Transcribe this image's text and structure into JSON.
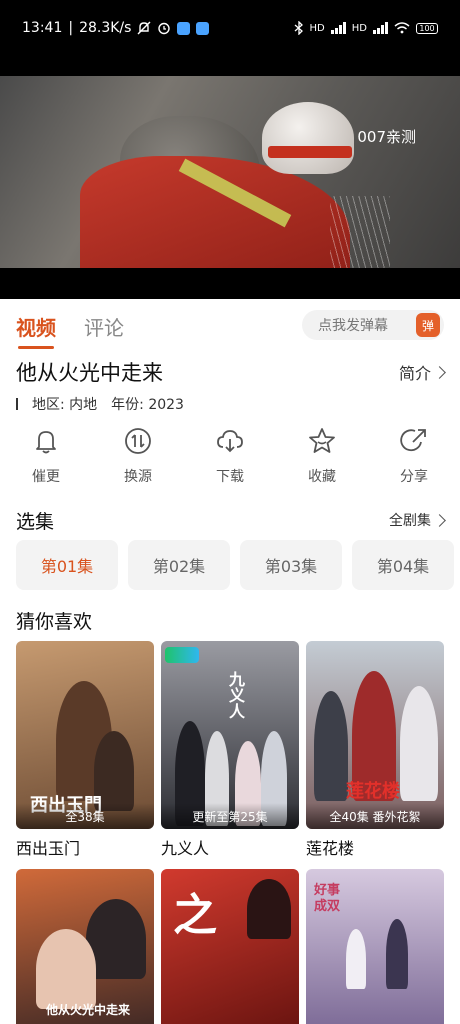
{
  "status_bar": {
    "time": "13:41",
    "net_speed": "28.3K/s",
    "hd1": "HD",
    "hd2": "HD",
    "battery": "100"
  },
  "video": {
    "watermark": "007亲测"
  },
  "tabs": [
    {
      "label": "视频",
      "active": true
    },
    {
      "label": "评论",
      "active": false
    }
  ],
  "danmu": {
    "placeholder": "点我发弹幕",
    "button": "弹"
  },
  "show": {
    "title": "他从火光中走来",
    "intro_label": "简介",
    "region_label": "地区: 内地",
    "year_label": "年份: 2023"
  },
  "actions": [
    {
      "icon": "bell-icon",
      "label": "催更"
    },
    {
      "icon": "switch-source-icon",
      "label": "换源"
    },
    {
      "icon": "download-icon",
      "label": "下载"
    },
    {
      "icon": "star-icon",
      "label": "收藏"
    },
    {
      "icon": "share-icon",
      "label": "分享"
    }
  ],
  "episodes_section": {
    "title": "选集",
    "all_label": "全剧集"
  },
  "episodes": [
    {
      "label": "第01集",
      "active": true
    },
    {
      "label": "第02集",
      "active": false
    },
    {
      "label": "第03集",
      "active": false
    },
    {
      "label": "第04集",
      "active": false
    }
  ],
  "recommend_section": {
    "title": "猜你喜欢"
  },
  "recommend": [
    {
      "title": "西出玉门",
      "caption": "全38集",
      "poster_script": "西出玉門",
      "colors": [
        "#b98a62",
        "#6b4a33"
      ]
    },
    {
      "title": "九义人",
      "caption": "更新至第25集",
      "poster_script": "九义人",
      "colors": [
        "#8d8e95",
        "#2c2d33"
      ]
    },
    {
      "title": "莲花楼",
      "caption": "全40集 番外花絮",
      "poster_script": "莲花楼",
      "colors": [
        "#bcc4cc",
        "#5e2a2a"
      ]
    },
    {
      "title": "",
      "caption": "",
      "poster_script": "他从火光中走来",
      "colors": [
        "#c4532c",
        "#2a1f22"
      ]
    },
    {
      "title": "",
      "caption": "",
      "poster_script": "之",
      "colors": [
        "#c22b22",
        "#5c0f0c"
      ]
    },
    {
      "title": "",
      "caption": "",
      "poster_script": "好事成双",
      "colors": [
        "#c9b8d4",
        "#6d5a8a"
      ]
    }
  ]
}
